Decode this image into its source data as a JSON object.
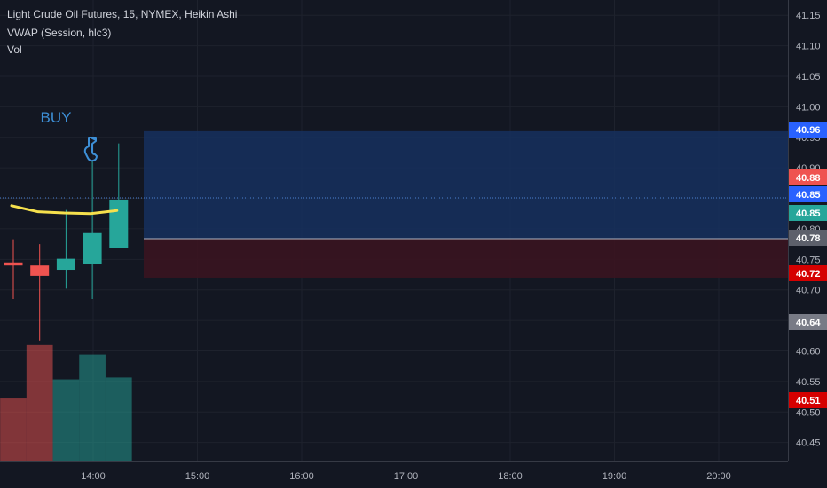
{
  "legend": {
    "line1": "Light Crude Oil Futures, 15, NYMEX, Heikin Ashi",
    "line2": "VWAP (Session, hlc3)",
    "line3": "Vol"
  },
  "annotation": {
    "text": "BUY",
    "icon": "hand-pointing-down-icon",
    "color": "#3d8fd6"
  },
  "colors": {
    "background": "#131722",
    "grid": "#1e222d",
    "up": "#26a69a",
    "down": "#ef5350",
    "vwap": "#f5e04d",
    "profit_zone": "#16305e",
    "loss_zone": "#3a1420"
  },
  "chart_data": {
    "type": "candlestick",
    "x_tick_labels": [
      "14:00",
      "15:00",
      "16:00",
      "17:00",
      "18:00",
      "19:00",
      "20:00"
    ],
    "y_tick_labels": [
      "41.15",
      "41.10",
      "41.05",
      "41.00",
      "40.95",
      "40.90",
      "40.85",
      "40.80",
      "40.75",
      "40.70",
      "40.65",
      "40.60",
      "40.55",
      "40.50",
      "40.45"
    ],
    "ylim": [
      40.419,
      41.175
    ],
    "series": [
      {
        "type": "heikin-ashi",
        "candles": [
          {
            "open": 40.745,
            "high": 40.783,
            "low": 40.685,
            "close": 40.74,
            "direction": "down"
          },
          {
            "open": 40.74,
            "high": 40.775,
            "low": 40.617,
            "close": 40.723,
            "direction": "down"
          },
          {
            "open": 40.733,
            "high": 40.831,
            "low": 40.702,
            "close": 40.751,
            "direction": "up"
          },
          {
            "open": 40.743,
            "high": 40.911,
            "low": 40.685,
            "close": 40.793,
            "direction": "up"
          },
          {
            "open": 40.768,
            "high": 40.94,
            "low": 40.784,
            "close": 40.848,
            "direction": "up"
          }
        ]
      },
      {
        "type": "vwap",
        "points": [
          40.838,
          40.828,
          40.826,
          40.825,
          40.83
        ]
      },
      {
        "type": "volume",
        "values": [
          0.33,
          0.61,
          0.43,
          0.56,
          0.44
        ],
        "directions": [
          "down",
          "down",
          "up",
          "up",
          "up"
        ]
      }
    ],
    "position": {
      "entry": 40.784,
      "target": 40.96,
      "stop": 40.72
    },
    "price_badges": [
      {
        "value": "40.96",
        "color": "#2962ff"
      },
      {
        "value": "40.88",
        "color": "#ef5350"
      },
      {
        "value": "40.85",
        "color": "#2962ff"
      },
      {
        "value": "40.85",
        "color": "#26a69a"
      },
      {
        "value": "40.78",
        "color": "#5d606b"
      },
      {
        "value": "40.72",
        "color": "#d50000"
      },
      {
        "value": "40.64",
        "color": "#787b86"
      },
      {
        "value": "40.51",
        "color": "#d50000"
      }
    ]
  }
}
